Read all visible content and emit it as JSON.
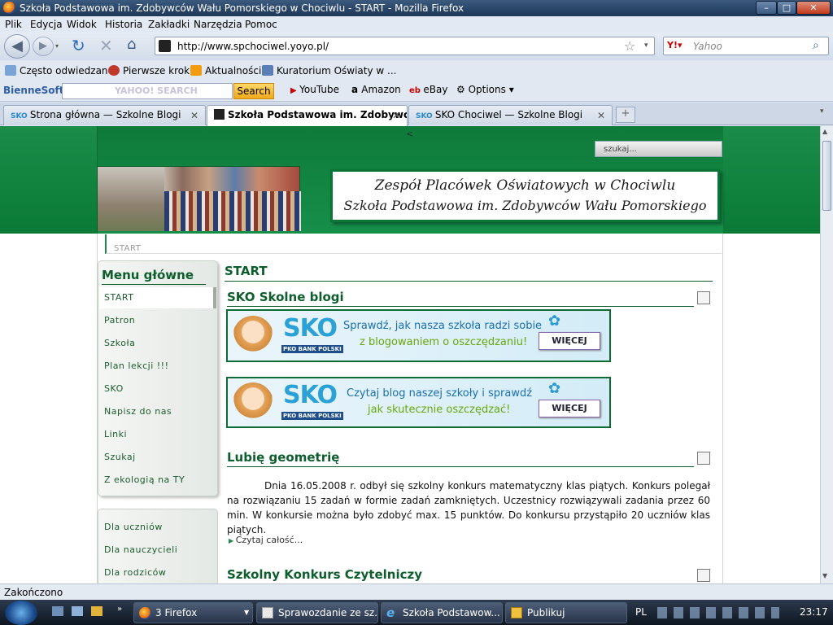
{
  "window": {
    "title": "Szkoła Podstawowa im. Zdobywców Wału Pomorskiego w Chociwlu - START - Mozilla Firefox"
  },
  "menu": [
    "Plik",
    "Edycja",
    "Widok",
    "Historia",
    "Zakładki",
    "Narzędzia",
    "Pomoc"
  ],
  "nav": {
    "url": "http://www.spchociwel.yoyo.pl/",
    "search_placeholder": "Yahoo"
  },
  "bookmarks": [
    "Często odwiedzane",
    "Pierwsze kroki",
    "Aktualności",
    "Kuratorium Oświaty w ..."
  ],
  "ytoolbar": {
    "brand": "BienneSoft",
    "search_placeholder": "YAHOO! SEARCH",
    "search_button": "Search",
    "links": [
      "YouTube",
      "Amazon",
      "eBay",
      "Options"
    ]
  },
  "tabs": [
    {
      "label": "Strona główna — Szkolne Blogi"
    },
    {
      "label": "Szkoła Podstawowa im. Zdobywc..."
    },
    {
      "label": "SKO Chociwel — Szkolne Blogi"
    }
  ],
  "site": {
    "search_placeholder": "szukaj...",
    "header_line1": "Zespół Placówek Oświatowych w Chociwlu",
    "header_line2": "Szkoła Podstawowa im. Zdobywców Wału Pomorskiego",
    "breadcrumb": "START",
    "menu_title": "Menu główne",
    "menu_items": [
      "START",
      "Patron",
      "Szkoła",
      "Plan lekcji !!!",
      "SKO",
      "Napisz do nas",
      "Linki",
      "Szukaj",
      "Z ekologią na TY"
    ],
    "menu2_items": [
      "Dla uczniów",
      "Dla nauczycieli",
      "Dla rodziców"
    ],
    "content_title": "START",
    "article1_title": "SKO Skolne blogi",
    "banner1": {
      "text1": "Sprawdź, jak nasza szkoła radzi sobie",
      "text2": "z blogowaniem o oszczędzaniu!",
      "button": "WIĘCEJ",
      "brand": "SKO",
      "sub": "PKO BANK POLSKI"
    },
    "banner2": {
      "text1": "Czytaj blog naszej szkoły i sprawdź",
      "text2": "jak skutecznie oszczędzać!",
      "button": "WIĘCEJ",
      "brand": "SKO",
      "sub": "PKO BANK POLSKI"
    },
    "article2_title": "Lubię geometrię",
    "article2_text": "Dnia 16.05.2008 r. odbył się szkolny konkurs matematyczny klas piątych. Konkurs polegał na rozwiązaniu 15 zadań w formie zadań zamkniętych. Uczestnicy rozwiązywali zadania przez 60 min. W konkursie można było zdobyć max. 15 punktów. Do konkursu przystąpiło 20 uczniów klas piątych.",
    "readmore": "Czytaj całość...",
    "article3_title": "Szkolny Konkurs Czytelniczy"
  },
  "status": "Zakończono",
  "taskbar": {
    "items": [
      "3 Firefox",
      "Sprawozdanie ze sz...",
      "Szkoła Podstawow...",
      "Publikuj"
    ],
    "lang": "PL",
    "clock": "23:17"
  }
}
